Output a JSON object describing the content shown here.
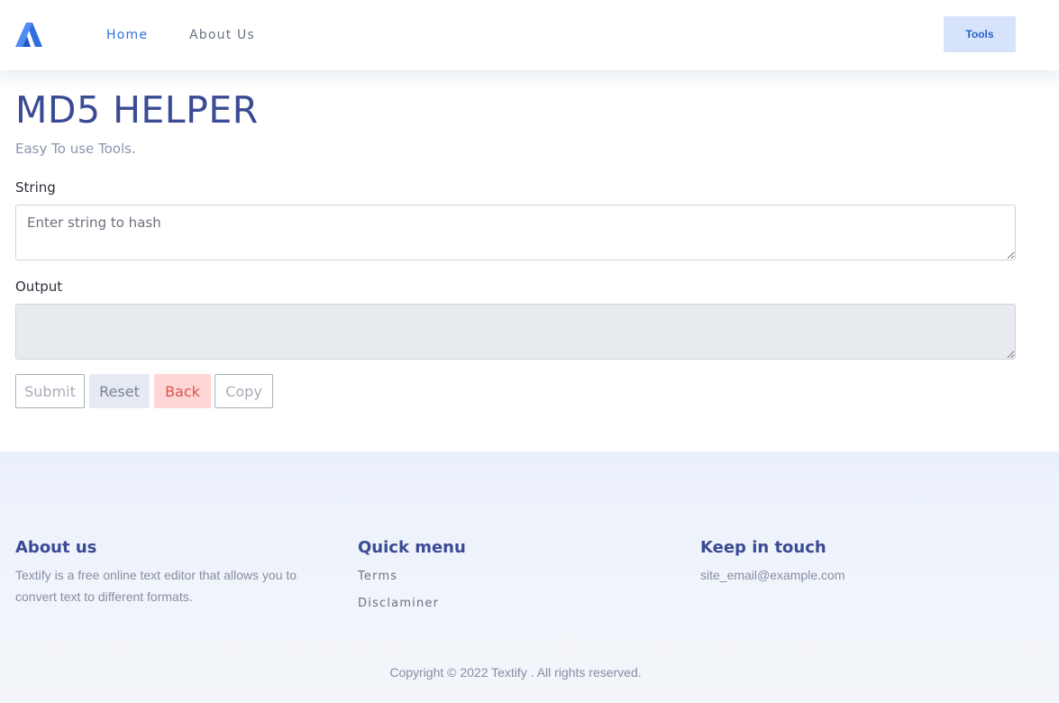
{
  "header": {
    "logo_icon": "brand-logo-icon",
    "brand_color": "#2f6fe0",
    "nav": [
      {
        "label": "Home",
        "active": true
      },
      {
        "label": "About Us",
        "active": false
      }
    ],
    "tools_label": "Tools"
  },
  "main": {
    "title": "MD5 HELPER",
    "subtitle": "Easy To use Tools.",
    "string_label": "String",
    "string_placeholder": "Enter string to hash",
    "string_value": "",
    "output_label": "Output",
    "output_value": "",
    "buttons": {
      "submit": "Submit",
      "reset": "Reset",
      "back": "Back",
      "copy": "Copy"
    }
  },
  "footer": {
    "about_heading": "About us",
    "about_text": "Textify is a free online text editor that allows you to convert text to different formats.",
    "quick_heading": "Quick menu",
    "quick_links": [
      "Terms",
      "Disclaminer"
    ],
    "contact_heading": "Keep in touch",
    "contact_email": "site_email@example.com",
    "copyright": "Copyright © 2022 Textify . All rights reserved."
  },
  "colors": {
    "title": "#3a4a94",
    "back_button_bg": "#ffd6d6",
    "reset_button_bg": "#e6ebf3",
    "tools_button_bg": "#d6e3fb",
    "footer_bg": "#eaf0fb"
  }
}
